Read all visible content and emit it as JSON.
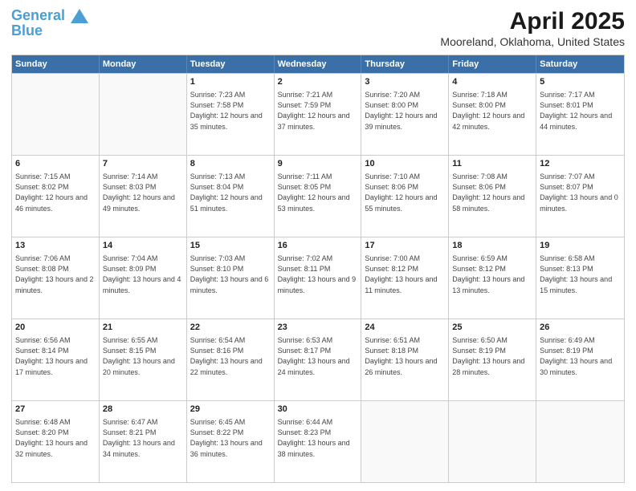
{
  "header": {
    "logo_line1": "General",
    "logo_line2": "Blue",
    "title": "April 2025",
    "subtitle": "Mooreland, Oklahoma, United States"
  },
  "days_of_week": [
    "Sunday",
    "Monday",
    "Tuesday",
    "Wednesday",
    "Thursday",
    "Friday",
    "Saturday"
  ],
  "weeks": [
    [
      {
        "day": "",
        "info": ""
      },
      {
        "day": "",
        "info": ""
      },
      {
        "day": "1",
        "info": "Sunrise: 7:23 AM\nSunset: 7:58 PM\nDaylight: 12 hours and 35 minutes."
      },
      {
        "day": "2",
        "info": "Sunrise: 7:21 AM\nSunset: 7:59 PM\nDaylight: 12 hours and 37 minutes."
      },
      {
        "day": "3",
        "info": "Sunrise: 7:20 AM\nSunset: 8:00 PM\nDaylight: 12 hours and 39 minutes."
      },
      {
        "day": "4",
        "info": "Sunrise: 7:18 AM\nSunset: 8:00 PM\nDaylight: 12 hours and 42 minutes."
      },
      {
        "day": "5",
        "info": "Sunrise: 7:17 AM\nSunset: 8:01 PM\nDaylight: 12 hours and 44 minutes."
      }
    ],
    [
      {
        "day": "6",
        "info": "Sunrise: 7:15 AM\nSunset: 8:02 PM\nDaylight: 12 hours and 46 minutes."
      },
      {
        "day": "7",
        "info": "Sunrise: 7:14 AM\nSunset: 8:03 PM\nDaylight: 12 hours and 49 minutes."
      },
      {
        "day": "8",
        "info": "Sunrise: 7:13 AM\nSunset: 8:04 PM\nDaylight: 12 hours and 51 minutes."
      },
      {
        "day": "9",
        "info": "Sunrise: 7:11 AM\nSunset: 8:05 PM\nDaylight: 12 hours and 53 minutes."
      },
      {
        "day": "10",
        "info": "Sunrise: 7:10 AM\nSunset: 8:06 PM\nDaylight: 12 hours and 55 minutes."
      },
      {
        "day": "11",
        "info": "Sunrise: 7:08 AM\nSunset: 8:06 PM\nDaylight: 12 hours and 58 minutes."
      },
      {
        "day": "12",
        "info": "Sunrise: 7:07 AM\nSunset: 8:07 PM\nDaylight: 13 hours and 0 minutes."
      }
    ],
    [
      {
        "day": "13",
        "info": "Sunrise: 7:06 AM\nSunset: 8:08 PM\nDaylight: 13 hours and 2 minutes."
      },
      {
        "day": "14",
        "info": "Sunrise: 7:04 AM\nSunset: 8:09 PM\nDaylight: 13 hours and 4 minutes."
      },
      {
        "day": "15",
        "info": "Sunrise: 7:03 AM\nSunset: 8:10 PM\nDaylight: 13 hours and 6 minutes."
      },
      {
        "day": "16",
        "info": "Sunrise: 7:02 AM\nSunset: 8:11 PM\nDaylight: 13 hours and 9 minutes."
      },
      {
        "day": "17",
        "info": "Sunrise: 7:00 AM\nSunset: 8:12 PM\nDaylight: 13 hours and 11 minutes."
      },
      {
        "day": "18",
        "info": "Sunrise: 6:59 AM\nSunset: 8:12 PM\nDaylight: 13 hours and 13 minutes."
      },
      {
        "day": "19",
        "info": "Sunrise: 6:58 AM\nSunset: 8:13 PM\nDaylight: 13 hours and 15 minutes."
      }
    ],
    [
      {
        "day": "20",
        "info": "Sunrise: 6:56 AM\nSunset: 8:14 PM\nDaylight: 13 hours and 17 minutes."
      },
      {
        "day": "21",
        "info": "Sunrise: 6:55 AM\nSunset: 8:15 PM\nDaylight: 13 hours and 20 minutes."
      },
      {
        "day": "22",
        "info": "Sunrise: 6:54 AM\nSunset: 8:16 PM\nDaylight: 13 hours and 22 minutes."
      },
      {
        "day": "23",
        "info": "Sunrise: 6:53 AM\nSunset: 8:17 PM\nDaylight: 13 hours and 24 minutes."
      },
      {
        "day": "24",
        "info": "Sunrise: 6:51 AM\nSunset: 8:18 PM\nDaylight: 13 hours and 26 minutes."
      },
      {
        "day": "25",
        "info": "Sunrise: 6:50 AM\nSunset: 8:19 PM\nDaylight: 13 hours and 28 minutes."
      },
      {
        "day": "26",
        "info": "Sunrise: 6:49 AM\nSunset: 8:19 PM\nDaylight: 13 hours and 30 minutes."
      }
    ],
    [
      {
        "day": "27",
        "info": "Sunrise: 6:48 AM\nSunset: 8:20 PM\nDaylight: 13 hours and 32 minutes."
      },
      {
        "day": "28",
        "info": "Sunrise: 6:47 AM\nSunset: 8:21 PM\nDaylight: 13 hours and 34 minutes."
      },
      {
        "day": "29",
        "info": "Sunrise: 6:45 AM\nSunset: 8:22 PM\nDaylight: 13 hours and 36 minutes."
      },
      {
        "day": "30",
        "info": "Sunrise: 6:44 AM\nSunset: 8:23 PM\nDaylight: 13 hours and 38 minutes."
      },
      {
        "day": "",
        "info": ""
      },
      {
        "day": "",
        "info": ""
      },
      {
        "day": "",
        "info": ""
      }
    ]
  ]
}
